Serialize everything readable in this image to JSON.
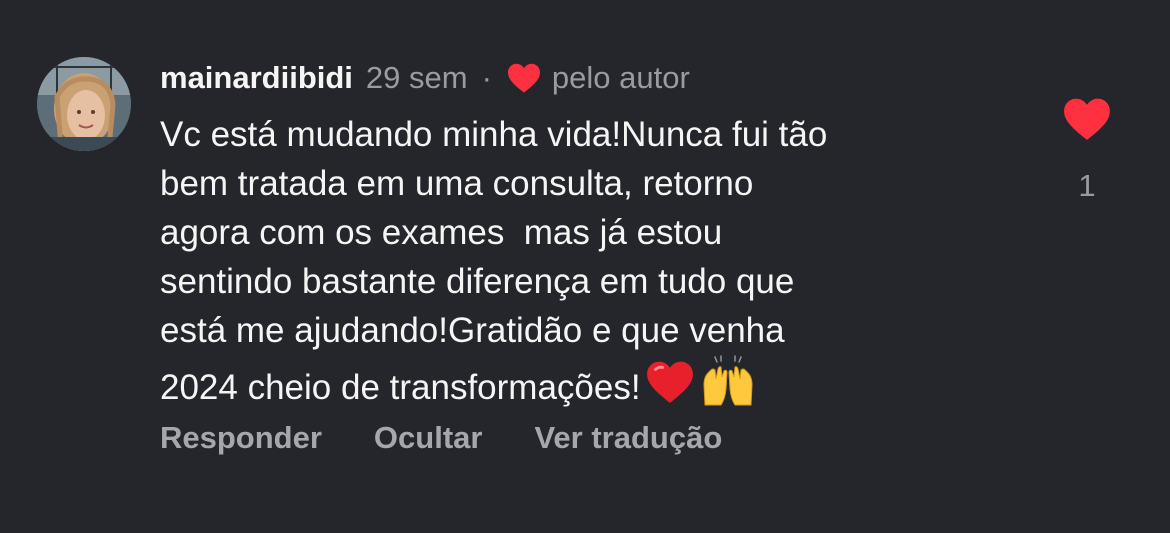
{
  "comment": {
    "username": "mainardiibidi",
    "timestamp": "29 sem",
    "separator": "·",
    "author_like_label": "pelo autor",
    "body_lines": [
      "Vc está mudando minha vida!Nunca fui tão",
      "bem tratada em uma consulta, retorno",
      "agora com os exames  mas já estou",
      "sentindo bastante diferença em tudo que",
      "está me ajudando!Gratidão e que venha",
      "2024 cheio de transformações!"
    ],
    "trailing_emojis": [
      "red-heart-emoji",
      "raising-hands-emoji"
    ],
    "like_count": "1",
    "actions": {
      "reply": "Responder",
      "hide": "Ocultar",
      "translate": "Ver tradução"
    }
  },
  "colors": {
    "background": "#25262b",
    "text_primary": "#f5f5f5",
    "text_secondary": "#9a9ba1",
    "heart_red": "#ff3040"
  }
}
